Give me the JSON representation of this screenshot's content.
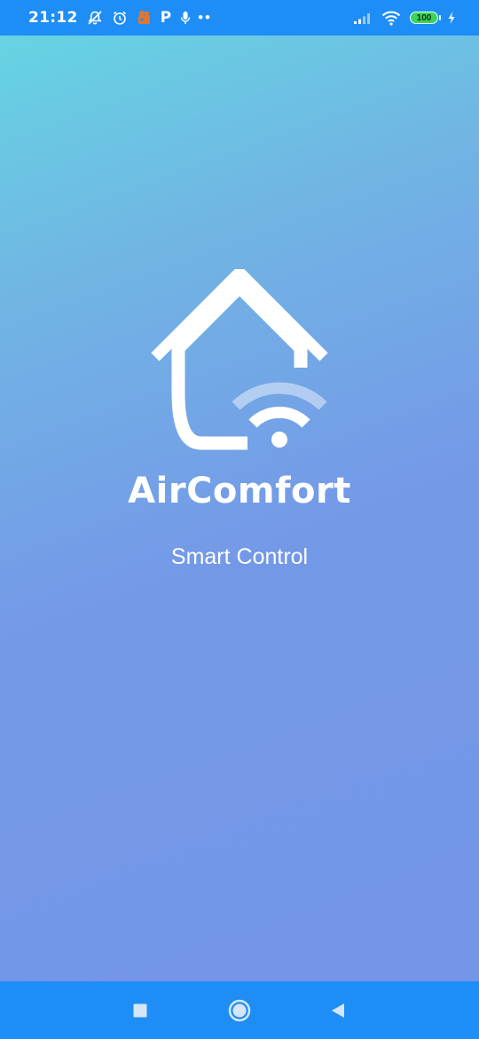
{
  "status_bar": {
    "time": "21:12",
    "battery_level": "100",
    "icons": [
      "notifications-off-icon",
      "alarm-icon",
      "app-notification-icon",
      "p-icon",
      "mic-icon",
      "more-dots-icon",
      "signal-icon",
      "wifi-icon",
      "battery-icon",
      "charging-icon"
    ],
    "p_label": "P",
    "dots_label": "••"
  },
  "splash": {
    "app_name": "AirComfort",
    "tagline": "Smart Control",
    "logo_icon": "home-wifi-icon"
  },
  "nav_bar": {
    "buttons": [
      "recent-apps-icon",
      "home-icon",
      "back-icon"
    ]
  },
  "colors": {
    "status_bar": "#1f8df6",
    "gradient_top": "#66d4e2",
    "gradient_bottom": "#7396e8",
    "text": "#ffffff",
    "battery": "#3bd45a"
  }
}
